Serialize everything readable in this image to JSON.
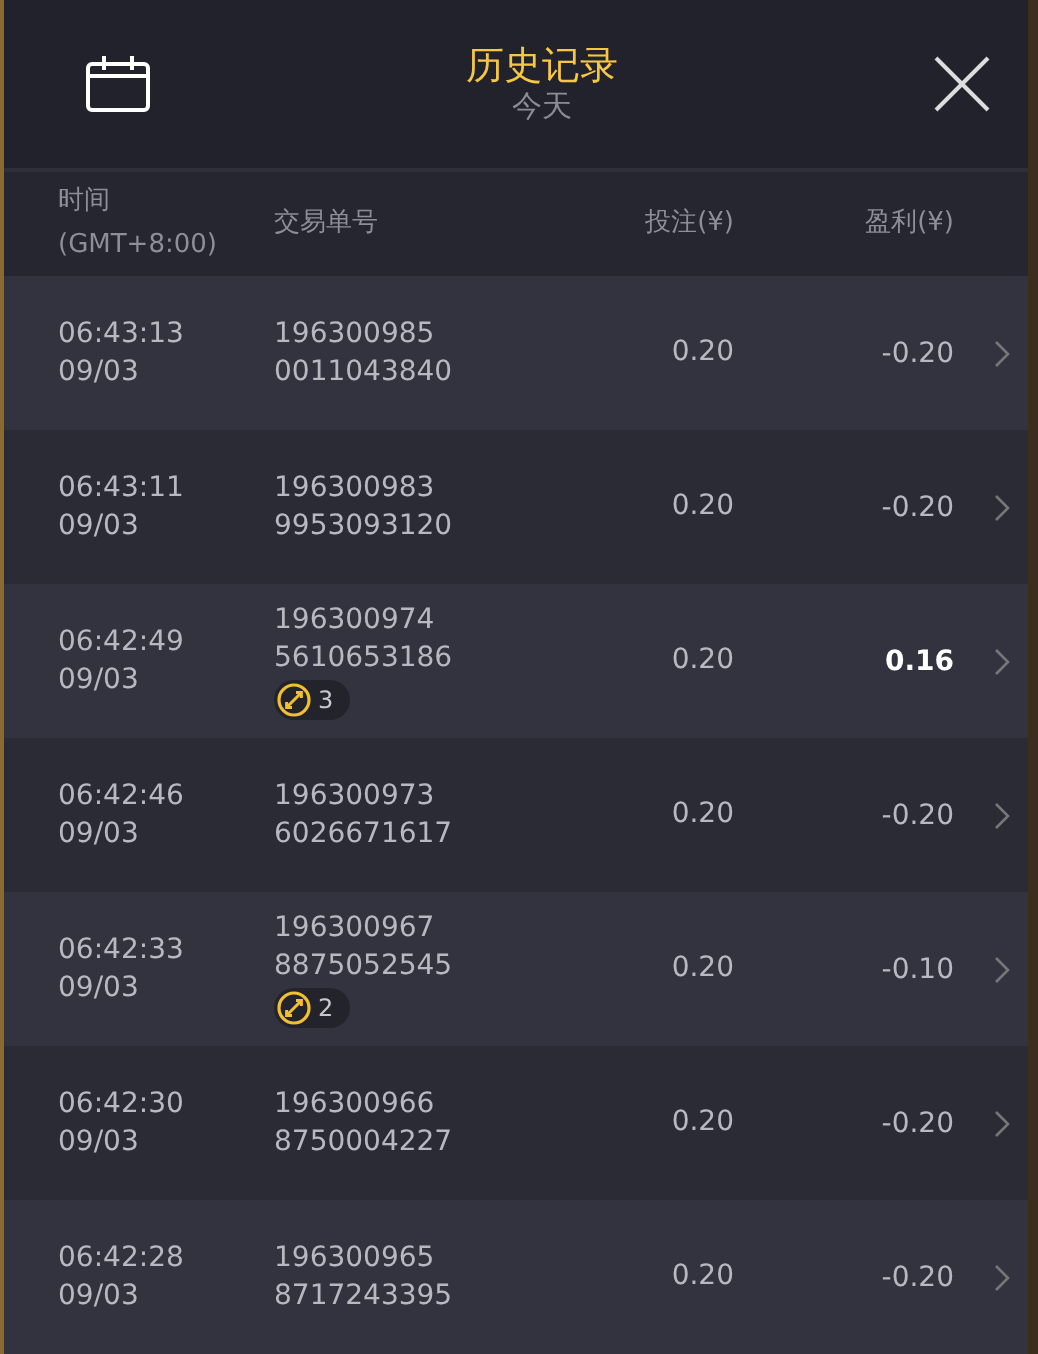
{
  "header": {
    "title": "历史记录",
    "subtitle": "今天"
  },
  "columns": [
    {
      "lines": [
        "时间",
        "(GMT+8:00)"
      ]
    },
    {
      "lines": [
        "交易单号"
      ]
    },
    {
      "lines": [
        "投注(¥)"
      ]
    },
    {
      "lines": [
        "盈利(¥)"
      ]
    }
  ],
  "rows": [
    {
      "time": "06:43:13",
      "date": "09/03",
      "id_lines": [
        "196300985",
        "0011043840"
      ],
      "bet": "0.20",
      "profit": "-0.20",
      "highlight": false
    },
    {
      "time": "06:43:11",
      "date": "09/03",
      "id_lines": [
        "196300983",
        "9953093120"
      ],
      "bet": "0.20",
      "profit": "-0.20",
      "highlight": false
    },
    {
      "time": "06:42:49",
      "date": "09/03",
      "id_lines": [
        "196300974",
        "5610653186"
      ],
      "badge": "3",
      "bet": "0.20",
      "profit": "0.16",
      "highlight": true
    },
    {
      "time": "06:42:46",
      "date": "09/03",
      "id_lines": [
        "196300973",
        "6026671617"
      ],
      "bet": "0.20",
      "profit": "-0.20",
      "highlight": false
    },
    {
      "time": "06:42:33",
      "date": "09/03",
      "id_lines": [
        "196300967",
        "8875052545"
      ],
      "badge": "2",
      "bet": "0.20",
      "profit": "-0.10",
      "highlight": false
    },
    {
      "time": "06:42:30",
      "date": "09/03",
      "id_lines": [
        "196300966",
        "8750004227"
      ],
      "bet": "0.20",
      "profit": "-0.20",
      "highlight": false
    },
    {
      "time": "06:42:28",
      "date": "09/03",
      "id_lines": [
        "196300965",
        "8717243395"
      ],
      "bet": "0.20",
      "profit": "-0.20",
      "highlight": false
    }
  ]
}
